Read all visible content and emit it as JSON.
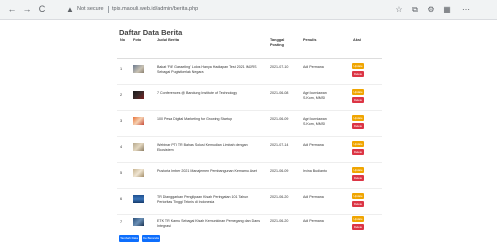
{
  "browser": {
    "back_icon": "←",
    "forward_icon": "→",
    "reload_icon": "C",
    "security_icon": "▲",
    "security_text": "Not secure",
    "url": "tpis.maouli.web.id/admin/berita.php",
    "toolbar_icons": [
      "☆",
      "⧉",
      "⚙",
      "▦",
      "⋯"
    ]
  },
  "page": {
    "heading": "Daftar Data Berita"
  },
  "table": {
    "headers": {
      "no": "No",
      "foto": "Foto",
      "judul": "Judul Berita",
      "tanggal": "Tanggal Posting",
      "penulis": "Penulis",
      "aksi": "Aksi"
    },
    "edit_label": "Update",
    "delete_label": "Delete",
    "rows": [
      {
        "no": "1",
        "title": "Bakat 'Fill' Gasseling' Lolos Hanya Hadiapan Test 2021 IMJRS Sebagai Pugistkerlak Negara",
        "date": "2021-07-10",
        "author": "Adi Permana"
      },
      {
        "no": "2",
        "title": "7 Conferences @ Bandung Institute of Technology",
        "date": "2021-06-08",
        "author": "Agri kurniawan S.Kom, MMSI"
      },
      {
        "no": "3",
        "title": "100 Pesa Digital Marketing for Growing Startup",
        "date": "2021-06-09",
        "author": "Agri kurniawan S.Kom, MMSI"
      },
      {
        "no": "4",
        "title": "Webinar PTI TR Bahas Solusi Kemudian Limbah dengan Ekosistem",
        "date": "2021-07-14",
        "author": "Adi Permana"
      },
      {
        "no": "5",
        "title": "Pustoria Imber 2021 Manajemen Pembangunan Kemamu Aset",
        "date": "2021-06-09",
        "author": "Irvina Budianto"
      },
      {
        "no": "6",
        "title": "TR Dianggarkan Penglipaan Kisah Peringatan 101 Tahun Perioritas Tinggi Teknis di Indonesia",
        "date": "2021-06-20",
        "author": "Adi Permana"
      },
      {
        "no": "7",
        "title": "ETK TR Kamu Sebagai Kisah Kemunkinan Pemegang dan Dans Integrasi",
        "date": "2021-06-20",
        "author": "Adi Permana"
      }
    ]
  },
  "footer": {
    "add_label": "Tambah Data",
    "other_label": "Ke Beranda"
  },
  "colors": {
    "edit": "#f0a500",
    "delete": "#dc3545",
    "primary": "#0d6efd"
  }
}
